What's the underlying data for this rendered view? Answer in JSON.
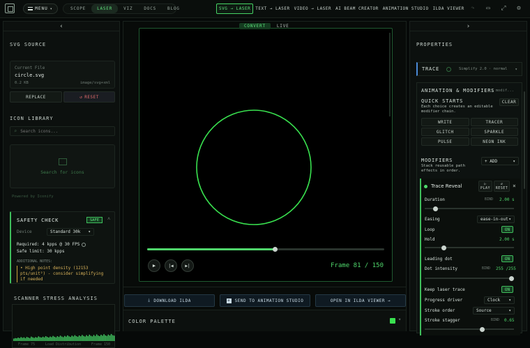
{
  "topbar": {
    "menu_label": "MENU",
    "nav": [
      "SCOPE",
      "LASER",
      "VIZ",
      "DOCS",
      "BLOG"
    ],
    "modes": [
      "SVG → LASER",
      "TEXT → LASER",
      "VIDEO → LASER",
      "AI BEAM CREATOR",
      "ANIMATION STUDIO",
      "ILDA VIEWER"
    ]
  },
  "left": {
    "svg_source_title": "SVG SOURCE",
    "file": {
      "label": "Current File",
      "name": "circle.svg",
      "size": "0.2 KB",
      "type": "image/svg+xml"
    },
    "replace_label": "REPLACE",
    "reset_label": "RESET",
    "icon_library_title": "ICON LIBRARY",
    "search_placeholder": "Search icons...",
    "search_empty": "Search for icons",
    "powered_by": "Powered by Iconify",
    "safety": {
      "title": "SAFETY CHECK",
      "badge": "SAFE",
      "device_label": "Device",
      "device_value": "Standard 30k",
      "required": "Required: 4 kpps @ 30 FPS",
      "limit": "Safe limit: 30 kpps",
      "notes_label": "ADDITIONAL NOTES:",
      "note": "• High point density (12153 pts/unit²) - consider simplifying if needed"
    },
    "stress_title": "SCANNER STRESS ANALYSIS",
    "stress_footer_left": "Frame 75",
    "stress_footer_mid": "Load Distribution",
    "stress_footer_right": "Frame 150",
    "stress_levels": [
      0.25,
      0.3,
      0.28,
      0.35,
      0.3,
      0.4,
      0.33,
      0.38,
      0.3,
      0.42,
      0.36,
      0.3,
      0.45,
      0.38,
      0.32,
      0.4,
      0.35,
      0.48,
      0.4,
      0.36,
      0.44,
      0.38,
      0.5,
      0.42,
      0.36,
      0.46,
      0.4,
      0.52,
      0.44,
      0.38,
      0.5,
      0.42,
      0.55,
      0.46,
      0.4,
      0.52,
      0.45,
      0.58,
      0.48,
      0.42,
      0.55,
      0.47,
      0.6,
      0.5,
      0.44,
      0.57,
      0.49,
      0.62,
      0.52,
      0.46,
      0.6,
      0.5,
      0.65,
      0.54,
      0.48,
      0.62,
      0.52,
      0.68,
      0.56,
      0.5,
      0.64,
      0.55,
      0.7,
      0.58,
      0.52,
      0.66,
      0.57,
      0.72,
      0.6,
      0.55
    ]
  },
  "center": {
    "tabs": [
      "CONVERT",
      "LIVE"
    ],
    "frame_text": "Frame 81 / 150",
    "progress": 0.54,
    "download_label": "DOWNLOAD ILDA",
    "send_label": "SEND TO ANIMATION STUDIO",
    "open_label": "OPEN IN ILDA VIEWER →",
    "palette_label": "COLOR PALETTE",
    "beam_color": "#39e14f"
  },
  "right": {
    "properties_title": "PROPERTIES",
    "trace_label": "TRACE",
    "trace_value": "Simplify 2.0 · normal",
    "anim_title": "ANIMATION & MODIFIERS",
    "anim_count": "1 modif...",
    "quick_title": "QUICK STARTS",
    "quick_desc": "Each choice creates an editable modifier chain.",
    "clear_label": "CLEAR",
    "quick": [
      "WRITE",
      "TRACER",
      "GLITCH",
      "SPARKLE",
      "PULSE",
      "NEON INK"
    ],
    "modifiers_title": "MODIFIERS",
    "modifiers_desc": "Stack reusable path effects in order.",
    "add_label": "+ ADD",
    "mod": {
      "name": "Trace Reveal",
      "play": "PLAY",
      "reset": "RESET",
      "duration_label": "Duration",
      "duration_bind": "BIND",
      "duration_value": "2.00 s",
      "duration_level": 0.1,
      "easing_label": "Easing",
      "easing_value": "ease-in-out",
      "loop_label": "Loop",
      "loop_value": "ON",
      "hold_label": "Hold",
      "hold_value": "2.00 s",
      "hold_level": 0.2,
      "leading_label": "Leading dot",
      "leading_value": "ON",
      "dot_label": "Dot intensity",
      "dot_bind": "BIND",
      "dot_value": "255 /255",
      "dot_level": 1.0,
      "keep_label": "Keep laser trace",
      "keep_value": "ON",
      "driver_label": "Progress driver",
      "driver_value": "Clock",
      "order_label": "Stroke order",
      "order_value": "Source",
      "stagger_label": "Stroke stagger",
      "stagger_bind": "BIND",
      "stagger_value": "0.65",
      "stagger_level": 0.65
    }
  }
}
